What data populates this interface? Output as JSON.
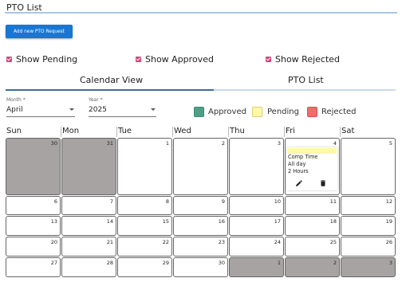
{
  "header": {
    "title": "PTO List"
  },
  "toolbar": {
    "add_label": "Add new PTO Request"
  },
  "filters": {
    "show_pending": "Show Pending",
    "show_approved": "Show Approved",
    "show_rejected": "Show Rejected",
    "checkbox_color": "#d1477a"
  },
  "tabs": [
    {
      "label": "Calendar View",
      "active": true
    },
    {
      "label": "PTO List",
      "active": false
    }
  ],
  "month_select": {
    "label": "Month *",
    "value": "April"
  },
  "year_select": {
    "label": "Year *",
    "value": "2025"
  },
  "legend": [
    {
      "label": "Approved",
      "color": "#4f9e86"
    },
    {
      "label": "Pending",
      "color": "#fff9a8"
    },
    {
      "label": "Rejected",
      "color": "#f36b6b"
    }
  ],
  "weekdays": [
    "Sun",
    "Mon",
    "Tue",
    "Wed",
    "Thu",
    "Fri",
    "Sat"
  ],
  "calendar": {
    "weeks": [
      [
        "30",
        "31",
        "1",
        "2",
        "3",
        "4",
        "5"
      ],
      [
        "6",
        "7",
        "8",
        "9",
        "10",
        "11",
        "12"
      ],
      [
        "13",
        "14",
        "15",
        "16",
        "17",
        "18",
        "19"
      ],
      [
        "20",
        "21",
        "22",
        "23",
        "24",
        "25",
        "26"
      ],
      [
        "27",
        "28",
        "29",
        "30",
        "1",
        "2",
        "3"
      ]
    ]
  },
  "event": {
    "type": "Comp Time",
    "duration": "All day",
    "hours": "2 Hours",
    "status_color": "#fff9a8",
    "edit_icon": "pencil-icon",
    "delete_icon": "trash-icon"
  }
}
